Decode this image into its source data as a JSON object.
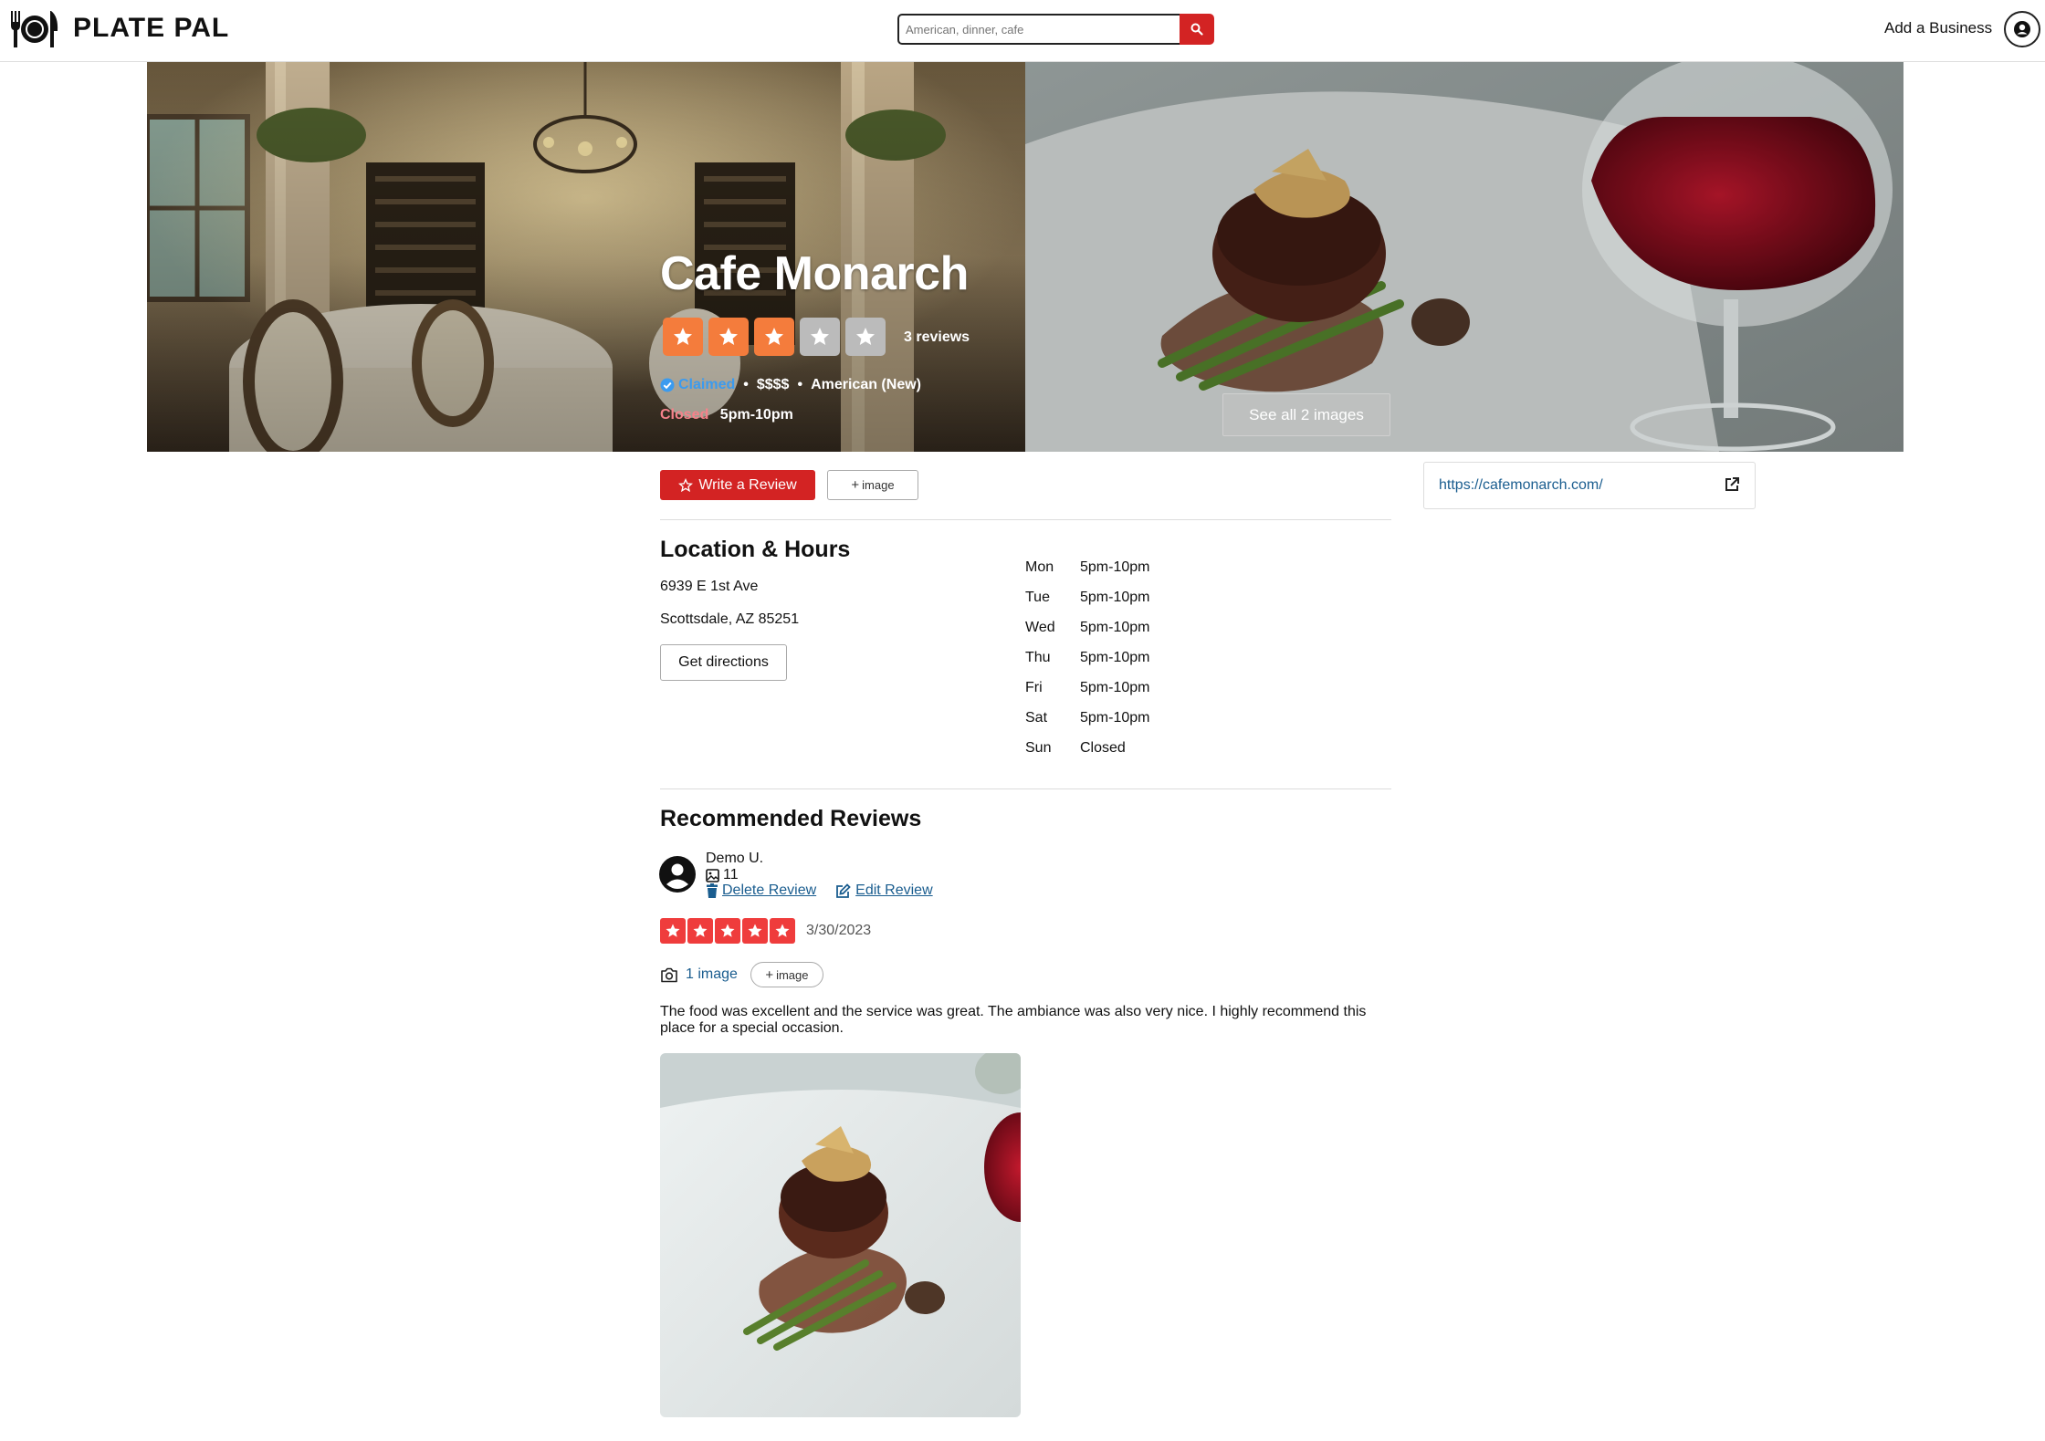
{
  "brand": {
    "name": "PLATE PAL"
  },
  "search": {
    "placeholder": "American, dinner, cafe"
  },
  "header": {
    "add_business": "Add a Business"
  },
  "business": {
    "name": "Cafe Monarch",
    "rating": 3,
    "rating_max": 5,
    "review_count": "3 reviews",
    "claimed": "Claimed",
    "price": "$$$$",
    "category": "American (New)",
    "status": "Closed",
    "today_hours": "5pm-10pm",
    "see_all_images": "See all 2 images",
    "website": "https://cafemonarch.com/"
  },
  "actions": {
    "write_review": "Write a Review",
    "add_image": "image"
  },
  "location": {
    "title": "Location & Hours",
    "address_line1": "6939 E 1st Ave",
    "address_line2": "Scottsdale, AZ 85251",
    "directions": "Get directions",
    "hours": [
      {
        "day": "Mon",
        "time": "5pm-10pm"
      },
      {
        "day": "Tue",
        "time": "5pm-10pm"
      },
      {
        "day": "Wed",
        "time": "5pm-10pm"
      },
      {
        "day": "Thu",
        "time": "5pm-10pm"
      },
      {
        "day": "Fri",
        "time": "5pm-10pm"
      },
      {
        "day": "Sat",
        "time": "5pm-10pm"
      },
      {
        "day": "Sun",
        "time": "Closed"
      }
    ]
  },
  "reviews": {
    "title": "Recommended Reviews",
    "items": [
      {
        "author": "Demo U.",
        "photo_stat": "11",
        "delete_label": "Delete Review",
        "edit_label": "Edit Review",
        "rating": 5,
        "date": "3/30/2023",
        "photos_label": "1 image",
        "add_image": "image",
        "text": "The food was excellent and the service was great. The ambiance was also very nice. I highly recommend this place for a special occasion."
      }
    ]
  },
  "colors": {
    "brand_red": "#d32323",
    "star_orange": "#f47c3c",
    "star_red": "#ef3c3c",
    "link_blue": "#1a5d8f",
    "claimed_blue": "#3b9bef",
    "closed_pink": "#f5828b"
  }
}
